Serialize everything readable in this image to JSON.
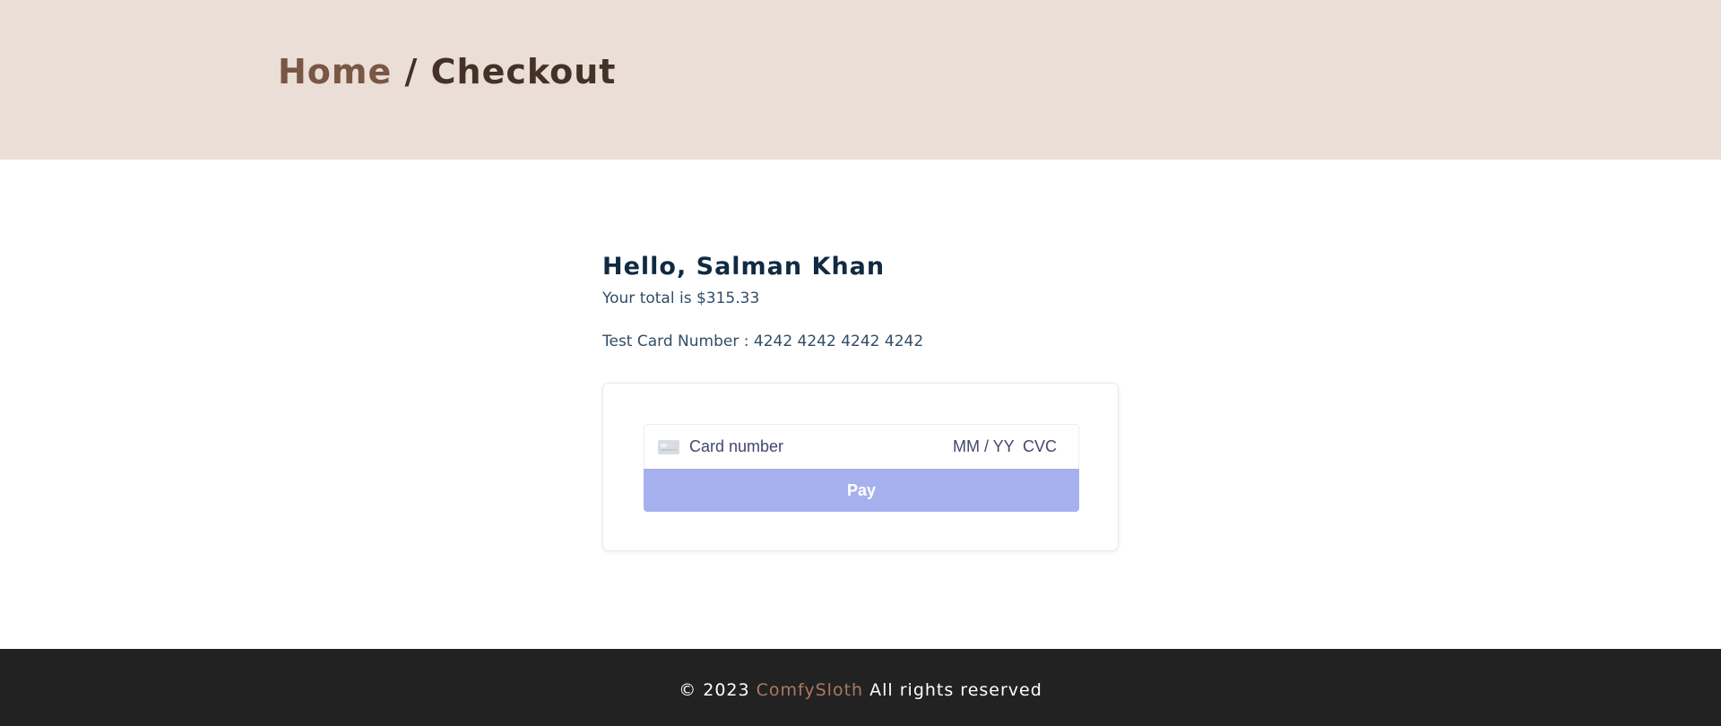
{
  "breadcrumb": {
    "home": "Home",
    "separator": " / ",
    "current": "Checkout"
  },
  "checkout": {
    "greeting": "Hello, Salman Khan",
    "total_text": "Your total is $315.33",
    "test_card_text": "Test Card Number : 4242 4242 4242 4242"
  },
  "payment_form": {
    "card_number_placeholder": "Card number",
    "expiry_placeholder": "MM / YY",
    "cvc_placeholder": "CVC",
    "pay_label": "Pay",
    "card_icon": "credit-card-icon",
    "pay_button_color": "#a7b0ee"
  },
  "footer": {
    "prefix": "© 2023 ",
    "brand": "ComfySloth",
    "suffix": " All rights reserved"
  },
  "colors": {
    "hero_bg": "#eaded7",
    "breadcrumb_link": "#795744",
    "breadcrumb_current": "#453227",
    "footer_bg": "#222222",
    "brand_accent": "#ab7a5f"
  }
}
